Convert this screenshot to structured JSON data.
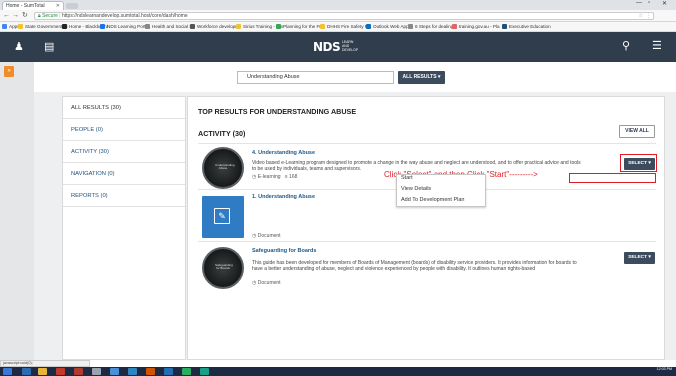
{
  "browser": {
    "tab_title": "Home - SumTotal",
    "url_prefix": "Secure",
    "url": "https://ndslearnandevelop.sumtotal.host/core/dash/home",
    "bookmarks": [
      {
        "label": "Apps",
        "color": "#4285f4"
      },
      {
        "label": "State Government Vi",
        "color": "#f1c232"
      },
      {
        "label": "Home - Blackboard",
        "color": "#222222"
      },
      {
        "label": "NDS Learning Portal",
        "color": "#1a73e8"
      },
      {
        "label": "Health and Social Se",
        "color": "#888888"
      },
      {
        "label": "Workforce developm",
        "color": "#555555"
      },
      {
        "label": "Sirius Training - Em",
        "color": "#f1c232"
      },
      {
        "label": "Planning for the Fut",
        "color": "#34a853"
      },
      {
        "label": "DHHS Fire Safety Ri",
        "color": "#f1c232"
      },
      {
        "label": "Outlook Web App",
        "color": "#0f6cbd"
      },
      {
        "label": "8 Steps for dealing",
        "color": "#888888"
      },
      {
        "label": "training.gov.au - Pla",
        "color": "#e06666"
      },
      {
        "label": "Executive Education",
        "color": "#1f4f7a"
      }
    ]
  },
  "header": {
    "logo_text": "NDS",
    "logo_sub": [
      "LEARN",
      "AND",
      "DEVELOP"
    ]
  },
  "search": {
    "value": "Understanding Abuse",
    "scope_label": "ALL RESULTS ▾"
  },
  "filters": [
    {
      "label": "ALL RESULTS (30)",
      "active": true
    },
    {
      "label": "PEOPLE (0)",
      "active": false
    },
    {
      "label": "ACTIVITY (30)",
      "active": false
    },
    {
      "label": "NAVIGATION (0)",
      "active": false
    },
    {
      "label": "REPORTS (0)",
      "active": false
    }
  ],
  "results": {
    "heading": "TOP RESULTS FOR UNDERSTANDING ABUSE",
    "activity_heading": "ACTIVITY (30)",
    "view_all": "VIEW ALL",
    "items": [
      {
        "title": "4. Understanding Abuse",
        "thumb_text": "Understanding Abuse",
        "description": "Video based e-Learning program designed to promote a change in the way abuse and neglect are understood, and to offer practical advice and tools to be used by individuals, teams and supervisors.",
        "meta_type": "E-learning",
        "meta_extra": "≡ 168",
        "select_label": "SELECT ▾"
      },
      {
        "title": "1. Understanding Abuse",
        "description": "",
        "meta_type": "Document",
        "select_label": ""
      },
      {
        "title": "Safeguarding for Boards",
        "thumb_text": "Safeguarding for Boards",
        "description": "This guide has been developed for members of Boards of Management (boards) of disability service providers. It provides information for boards to have a better understanding of abuse, neglect and violence experienced by people with disability. It outlines human rights-based",
        "meta_type": "Document",
        "select_label": "SELECT ▾"
      }
    ]
  },
  "dropdown": {
    "items": [
      "Start",
      "View Details",
      "Add To Development Plan"
    ]
  },
  "annotation": {
    "instruction": "Click \"Select\" and then Click \"Start\"--------->"
  },
  "status_bar": {
    "text": "javascript:void(0);"
  },
  "taskbar": {
    "time": "12:03 PM",
    "date": ""
  }
}
